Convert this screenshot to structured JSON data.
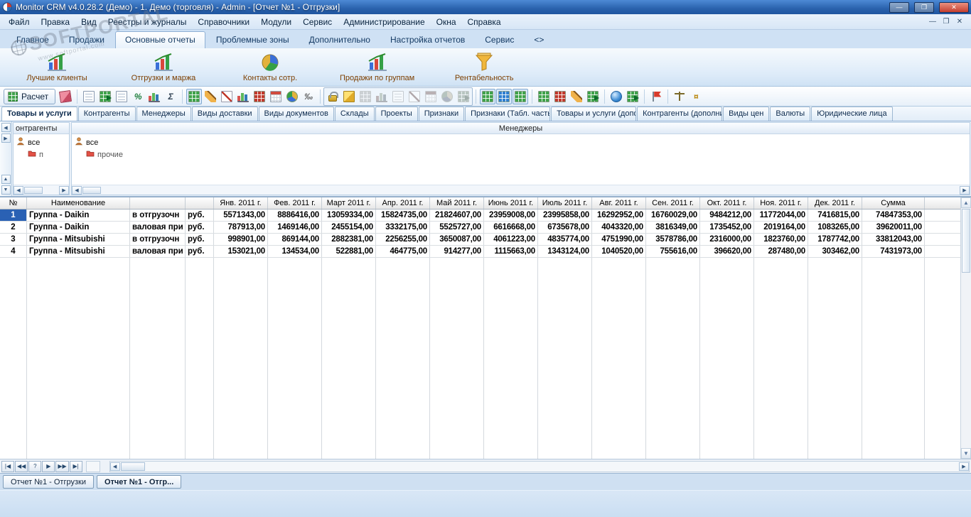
{
  "window": {
    "title": "Monitor CRM v4.0.28.2 (Демо) - 1. Демо (торговля) - Admin - [Отчет №1 - Отгрузки]",
    "buttons": {
      "minimize": "—",
      "restore": "❐",
      "close": "✕"
    }
  },
  "watermark": {
    "title": "SOFTPORTAL",
    "subtitle": "www.softportal.com"
  },
  "glyphs": {
    "up": "▲",
    "down": "▼",
    "left": "◀",
    "right": "▶"
  },
  "menu": {
    "items": [
      "Файл",
      "Правка",
      "Вид",
      "Реестры и журналы",
      "Справочники",
      "Модули",
      "Сервис",
      "Администрирование",
      "Окна",
      "Справка"
    ],
    "mdi_buttons": [
      "—",
      "❐",
      "✕"
    ]
  },
  "ribbon": {
    "tabs": [
      "Главное",
      "Продажи",
      "Основные отчеты",
      "Проблемные зоны",
      "Дополнительно",
      "Настройка отчетов",
      "Сервис",
      "<>"
    ],
    "active_tab": "Основные отчеты",
    "actions": [
      {
        "label": "Лучшие клиенты",
        "icon": "best-clients-chart-icon",
        "kind": "bars"
      },
      {
        "label": "Отгрузки и маржа",
        "icon": "shipments-margin-chart-icon",
        "kind": "bars"
      },
      {
        "label": "Контакты сотр.",
        "icon": "employee-contacts-pie-icon",
        "kind": "pie"
      },
      {
        "label": "Продажи по группам",
        "icon": "sales-by-groups-chart-icon",
        "kind": "bars"
      },
      {
        "label": "Рентабельность",
        "icon": "profitability-funnel-icon",
        "kind": "funnel"
      }
    ]
  },
  "toolbar": {
    "calc_label": "Расчет",
    "groups": [
      {
        "items": [
          {
            "name": "eraser",
            "type": "eraser"
          }
        ]
      },
      {
        "items": [
          {
            "name": "copy-report",
            "type": "doc"
          },
          {
            "name": "export-report",
            "type": "export"
          },
          {
            "name": "print-report",
            "type": "doc"
          },
          {
            "name": "percent-mode",
            "type": "text",
            "glyph": "%",
            "color": "#1a7d3a"
          },
          {
            "name": "chart-params",
            "type": "bars"
          },
          {
            "name": "sum-mode",
            "type": "text",
            "glyph": "Σ",
            "color": "#334455"
          }
        ]
      },
      {
        "items": [
          {
            "name": "table-view",
            "type": "grid",
            "color": "#3fa24a",
            "active": true
          },
          {
            "name": "edit-report",
            "type": "pencil"
          },
          {
            "name": "line-chart-view",
            "type": "line"
          },
          {
            "name": "bar-chart-view",
            "type": "bars"
          },
          {
            "name": "crosstab-view",
            "type": "grid",
            "color": "#c0392b"
          },
          {
            "name": "calendar-view",
            "type": "cal"
          },
          {
            "name": "pie-chart-view",
            "type": "pie"
          },
          {
            "name": "permille-mode",
            "type": "text",
            "glyph": "‰",
            "color": "#555555"
          }
        ]
      },
      {
        "boxed": true,
        "items": [
          {
            "name": "lock",
            "type": "lock"
          },
          {
            "name": "olap-cube",
            "type": "cube"
          },
          {
            "name": "disabled-grid",
            "type": "grid",
            "color": "#9aa7b5",
            "disabled": true
          },
          {
            "name": "disabled-bars",
            "type": "bars",
            "disabled": true
          },
          {
            "name": "disabled-doc",
            "type": "doc",
            "disabled": true
          },
          {
            "name": "disabled-line",
            "type": "line",
            "disabled": true
          },
          {
            "name": "disabled-calendar",
            "type": "cal",
            "disabled": true
          },
          {
            "name": "disabled-pie",
            "type": "pie",
            "disabled": true
          },
          {
            "name": "disabled-export",
            "type": "export",
            "disabled": true
          }
        ]
      },
      {
        "items": [
          {
            "name": "show-rows",
            "type": "grid",
            "color": "#3fa24a",
            "active": true
          },
          {
            "name": "show-columns",
            "type": "grid",
            "color": "#2f7fd0",
            "active": true
          },
          {
            "name": "show-totals",
            "type": "grid",
            "color": "#3fa24a",
            "active": true
          }
        ]
      },
      {
        "items": [
          {
            "name": "append-row",
            "type": "grid",
            "color": "#3fa24a"
          },
          {
            "name": "append-column",
            "type": "grid",
            "color": "#c0392b"
          },
          {
            "name": "edit-cell",
            "type": "pencil"
          },
          {
            "name": "export-table",
            "type": "export"
          }
        ]
      },
      {
        "items": [
          {
            "name": "refresh-data",
            "type": "globe"
          },
          {
            "name": "export-excel",
            "type": "export"
          }
        ]
      },
      {
        "items": [
          {
            "name": "flag",
            "type": "flag"
          }
        ]
      },
      {
        "items": [
          {
            "name": "scales",
            "type": "scales"
          },
          {
            "name": "currency-rates",
            "type": "text",
            "glyph": "¤",
            "color": "#b8860b"
          }
        ]
      }
    ]
  },
  "filter_tabs": {
    "items": [
      "Товары и услуги",
      "Контрагенты",
      "Менеджеры",
      "Виды доставки",
      "Виды документов",
      "Склады",
      "Проекты",
      "Признаки",
      "Признаки (Табл. часть",
      "Товары и услуги (допо",
      "Контрагенты (дополни",
      "Виды цен",
      "Валюты",
      "Юридические лица"
    ],
    "active": "Товары и услуги"
  },
  "filters": {
    "panel1": {
      "header": "онтрагенты",
      "root": "все",
      "child": "п"
    },
    "panel2": {
      "header": "Менеджеры",
      "root": "все",
      "child": "прочие"
    }
  },
  "table": {
    "columns": [
      "№",
      "Наименование",
      "",
      "",
      "Янв. 2011 г.",
      "Фев. 2011 г.",
      "Март 2011 г.",
      "Апр. 2011 г.",
      "Май 2011 г.",
      "Июнь 2011 г.",
      "Июль 2011 г.",
      "Авг. 2011 г.",
      "Сен. 2011 г.",
      "Окт. 2011 г.",
      "Ноя. 2011 г.",
      "Дек. 2011 г.",
      "Сумма"
    ],
    "selected_row": 0,
    "rows": [
      [
        "1",
        "Группа - Daikin",
        "в отгрузочн",
        "руб.",
        "5571343,00",
        "8886416,00",
        "13059334,00",
        "15824735,00",
        "21824607,00",
        "23959008,00",
        "23995858,00",
        "16292952,00",
        "16760029,00",
        "9484212,00",
        "11772044,00",
        "7416815,00",
        "74847353,00"
      ],
      [
        "2",
        "Группа - Daikin",
        "валовая при",
        "руб.",
        "787913,00",
        "1469146,00",
        "2455154,00",
        "3332175,00",
        "5525727,00",
        "6616668,00",
        "6735678,00",
        "4043320,00",
        "3816349,00",
        "1735452,00",
        "2019164,00",
        "1083265,00",
        "39620011,00"
      ],
      [
        "3",
        "Группа - Mitsubishi",
        "в отгрузочн",
        "руб.",
        "998901,00",
        "869144,00",
        "2882381,00",
        "2256255,00",
        "3650087,00",
        "4061223,00",
        "4835774,00",
        "4751990,00",
        "3578786,00",
        "2316000,00",
        "1823760,00",
        "1787742,00",
        "33812043,00"
      ],
      [
        "4",
        "Группа - Mitsubishi",
        "валовая при",
        "руб.",
        "153021,00",
        "134534,00",
        "522881,00",
        "464775,00",
        "914277,00",
        "1115663,00",
        "1343124,00",
        "1040520,00",
        "755616,00",
        "396620,00",
        "287480,00",
        "303462,00",
        "7431973,00"
      ]
    ]
  },
  "navigator": {
    "buttons": [
      {
        "name": "nav-first-button",
        "glyph": "|◀"
      },
      {
        "name": "nav-prior-button",
        "glyph": "◀◀"
      },
      {
        "name": "nav-help-button",
        "glyph": "?"
      },
      {
        "name": "nav-next-button",
        "glyph": "▶"
      },
      {
        "name": "nav-next-page-button",
        "glyph": "▶▶"
      },
      {
        "name": "nav-last-button",
        "glyph": "▶|"
      }
    ]
  },
  "bottom_tabs": {
    "items": [
      "Отчет №1 - Отгрузки",
      "Отчет №1 - Отгр..."
    ],
    "active_index": 1
  }
}
